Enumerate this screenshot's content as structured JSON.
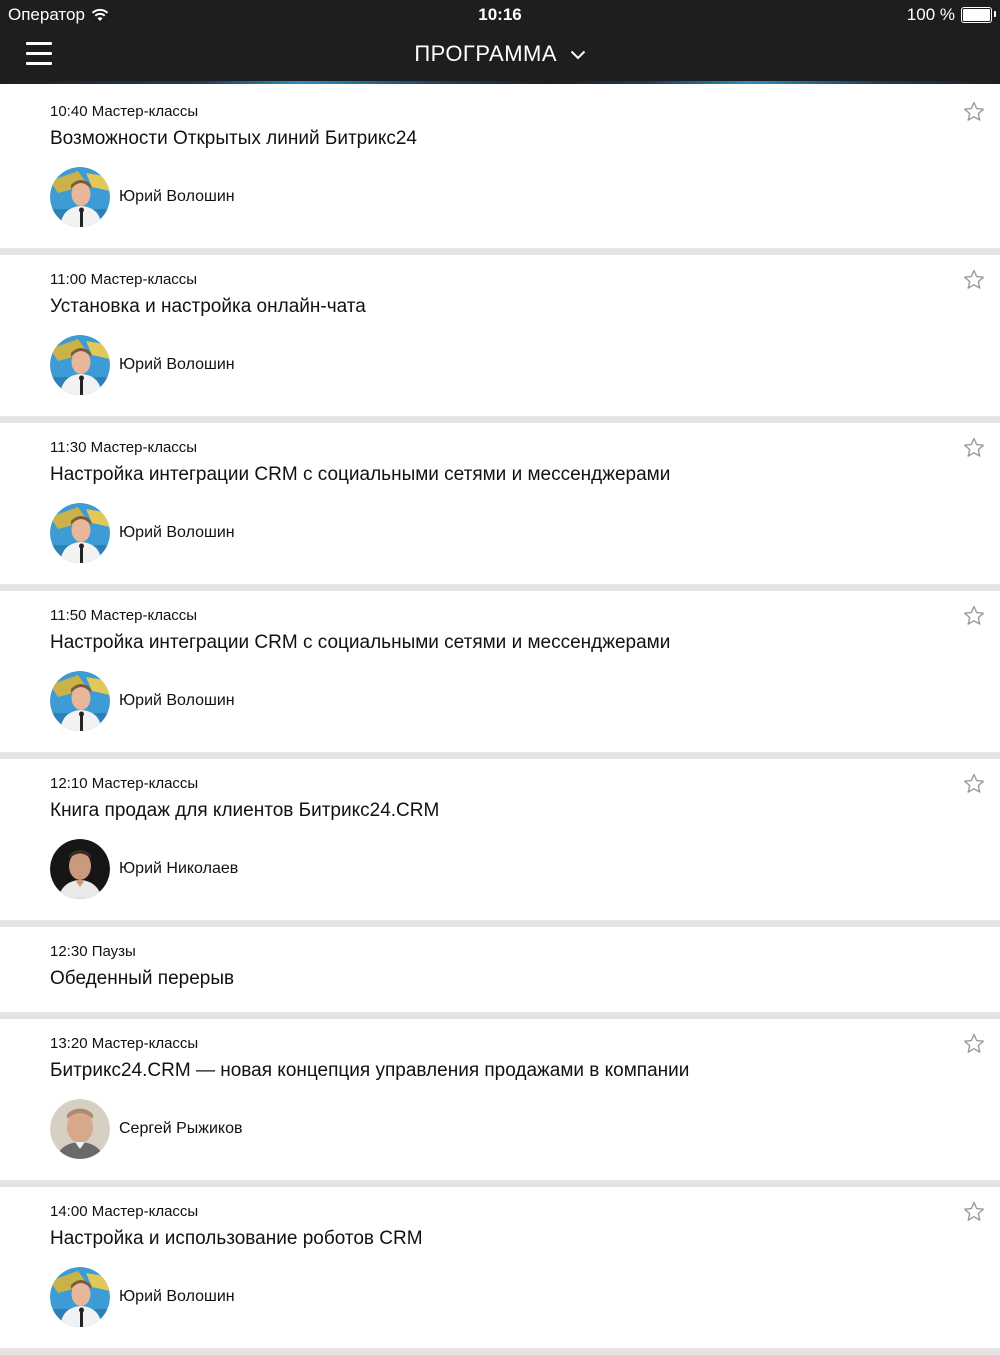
{
  "status_bar": {
    "carrier": "Оператор",
    "time": "10:16",
    "battery": "100 %"
  },
  "nav": {
    "title": "ПРОГРАММА",
    "menu_icon": "hamburger-icon",
    "dropdown_icon": "chevron-down-icon"
  },
  "colors": {
    "bar_bg": "#1e1e1e",
    "accent": "#2a8fc0",
    "separator": "#e4e4e4"
  },
  "sessions": [
    {
      "time_category": "10:40 Мастер-классы",
      "title": "Возможности Открытых линий Битрикс24",
      "speaker": "Юрий Волошин",
      "avatar": "volosh",
      "favorite": false
    },
    {
      "time_category": "11:00 Мастер-классы",
      "title": "Установка и настройка онлайн-чата",
      "speaker": "Юрий Волошин",
      "avatar": "volosh",
      "favorite": false
    },
    {
      "time_category": "11:30 Мастер-классы",
      "title": "Настройка интеграции CRM с социальными сетями и мессенджерами",
      "speaker": "Юрий Волошин",
      "avatar": "volosh",
      "favorite": false
    },
    {
      "time_category": "11:50 Мастер-классы",
      "title": "Настройка интеграции CRM с социальными сетями и мессенджерами",
      "speaker": "Юрий Волошин",
      "avatar": "volosh",
      "favorite": false
    },
    {
      "time_category": "12:10 Мастер-классы",
      "title": "Книга продаж для клиентов Битрикс24.CRM",
      "speaker": "Юрий Николаев",
      "avatar": "nikol",
      "favorite": false
    },
    {
      "time_category": "12:30 Паузы",
      "title": "Обеденный перерыв",
      "speaker": null,
      "avatar": null,
      "favorite": null
    },
    {
      "time_category": "13:20 Мастер-классы",
      "title": "Битрикс24.CRM — новая концепция управления продажами в компании",
      "speaker": "Сергей Рыжиков",
      "avatar": "ryzh",
      "favorite": false
    },
    {
      "time_category": "14:00 Мастер-классы",
      "title": "Настройка и использование роботов CRM",
      "speaker": "Юрий Волошин",
      "avatar": "volosh",
      "favorite": false
    }
  ]
}
